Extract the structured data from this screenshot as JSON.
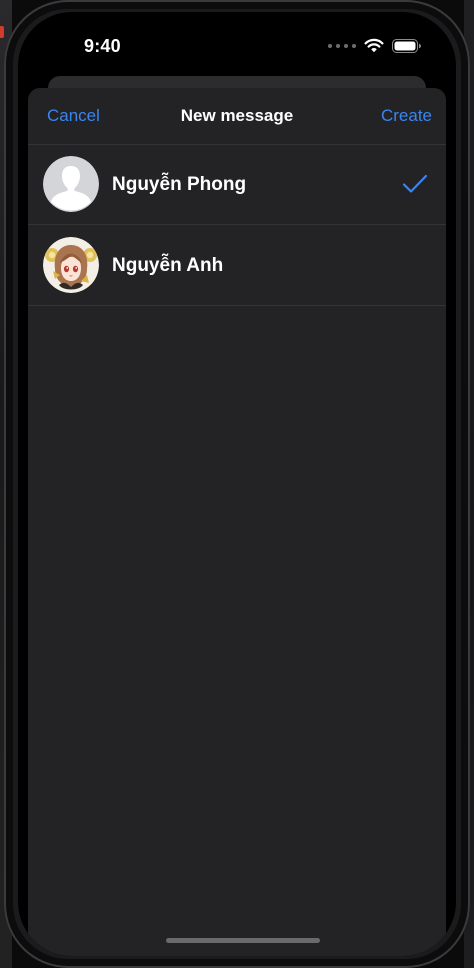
{
  "status_bar": {
    "time": "9:40",
    "icons": [
      "signal-dots-icon",
      "wifi-icon",
      "battery-icon"
    ]
  },
  "nav": {
    "cancel_label": "Cancel",
    "title": "New message",
    "create_label": "Create"
  },
  "contacts": [
    {
      "name": "Nguyễn Phong",
      "avatar": "default-person-avatar",
      "selected": true
    },
    {
      "name": "Nguyễn Anh",
      "avatar": "anime-character-avatar",
      "selected": false
    }
  ],
  "colors": {
    "accent": "#3a85f0",
    "sheet_background": "#232325",
    "separator": "#343436",
    "text_primary": "#ffffff"
  }
}
